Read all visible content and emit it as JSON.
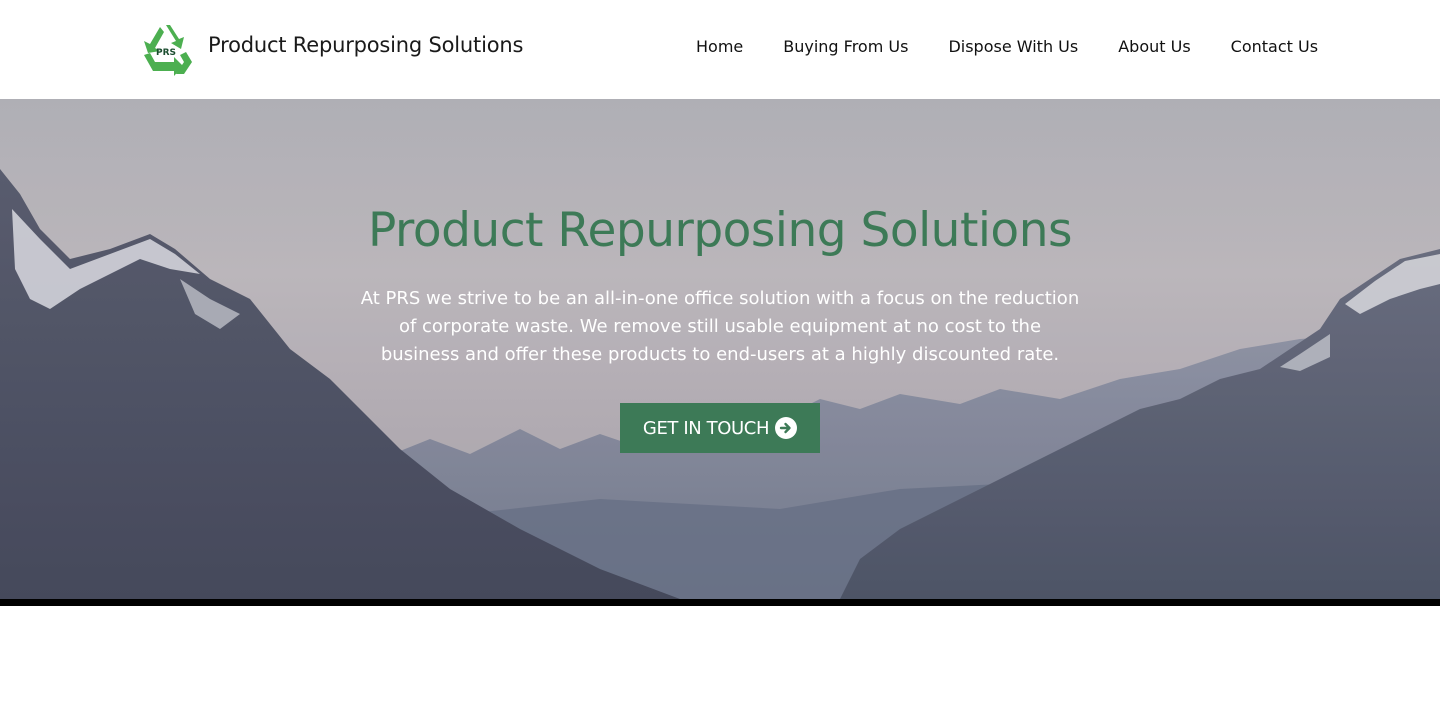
{
  "header": {
    "logo_text": "PRS",
    "brand": "Product Repurposing Solutions",
    "nav": [
      {
        "label": "Home"
      },
      {
        "label": "Buying From Us"
      },
      {
        "label": "Dispose With Us"
      },
      {
        "label": "About Us"
      },
      {
        "label": "Contact Us"
      }
    ]
  },
  "hero": {
    "title": "Product Repurposing Solutions",
    "description": "At PRS we strive to be an all-in-one office solution with a focus on the reduction of corporate waste. We remove still usable equipment at no cost to the business and offer these products to end-users at a highly discounted rate.",
    "cta_label": "GET IN TOUCH",
    "cta_icon": "arrow-circle-right-icon",
    "background": "mountain-landscape-image"
  },
  "colors": {
    "brand_green": "#3d7a57",
    "logo_green": "#4caf50",
    "divider": "#000000"
  }
}
